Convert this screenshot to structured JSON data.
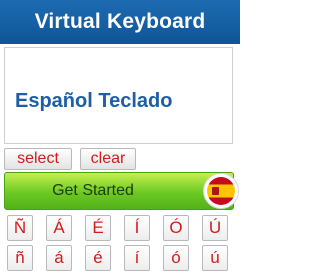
{
  "header": {
    "title": "Virtual Keyboard"
  },
  "editor": {
    "text": "Español Teclado"
  },
  "controls": {
    "select_label": "select",
    "clear_label": "clear"
  },
  "cta": {
    "label": "Get Started"
  },
  "keyboard": {
    "upper": [
      "Ñ",
      "Á",
      "É",
      "Í",
      "Ó",
      "Ú"
    ],
    "lower": [
      "ñ",
      "á",
      "é",
      "í",
      "ó",
      "ú"
    ]
  },
  "colors": {
    "header_bg": "#1565a8",
    "text_blue": "#1c5fa6",
    "key_text": "#d21b1b",
    "cta_green": "#6cc823"
  }
}
